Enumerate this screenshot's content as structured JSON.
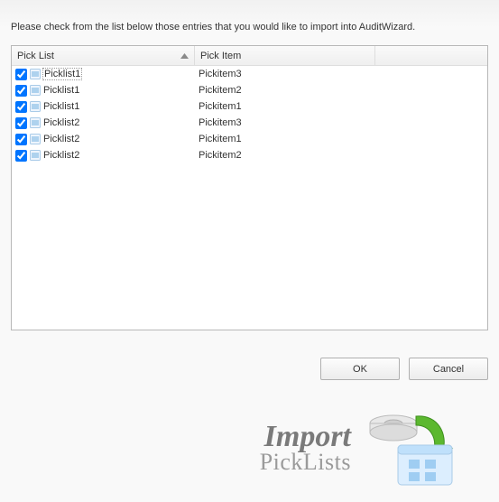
{
  "instruction": "Please check from the list below those entries that you would like to import into AuditWizard.",
  "columns": {
    "col0": "Pick List",
    "col1": "Pick Item",
    "col2": ""
  },
  "rows": [
    {
      "checked": true,
      "focused": true,
      "picklist": "Picklist1",
      "pickitem": "Pickitem3"
    },
    {
      "checked": true,
      "focused": false,
      "picklist": "Picklist1",
      "pickitem": "Pickitem2"
    },
    {
      "checked": true,
      "focused": false,
      "picklist": "Picklist1",
      "pickitem": "Pickitem1"
    },
    {
      "checked": true,
      "focused": false,
      "picklist": "Picklist2",
      "pickitem": "Pickitem3"
    },
    {
      "checked": true,
      "focused": false,
      "picklist": "Picklist2",
      "pickitem": "Pickitem1"
    },
    {
      "checked": true,
      "focused": false,
      "picklist": "Picklist2",
      "pickitem": "Pickitem2"
    }
  ],
  "buttons": {
    "ok": "OK",
    "cancel": "Cancel"
  },
  "footer": {
    "title": "Import",
    "subtitle": "PickLists"
  }
}
